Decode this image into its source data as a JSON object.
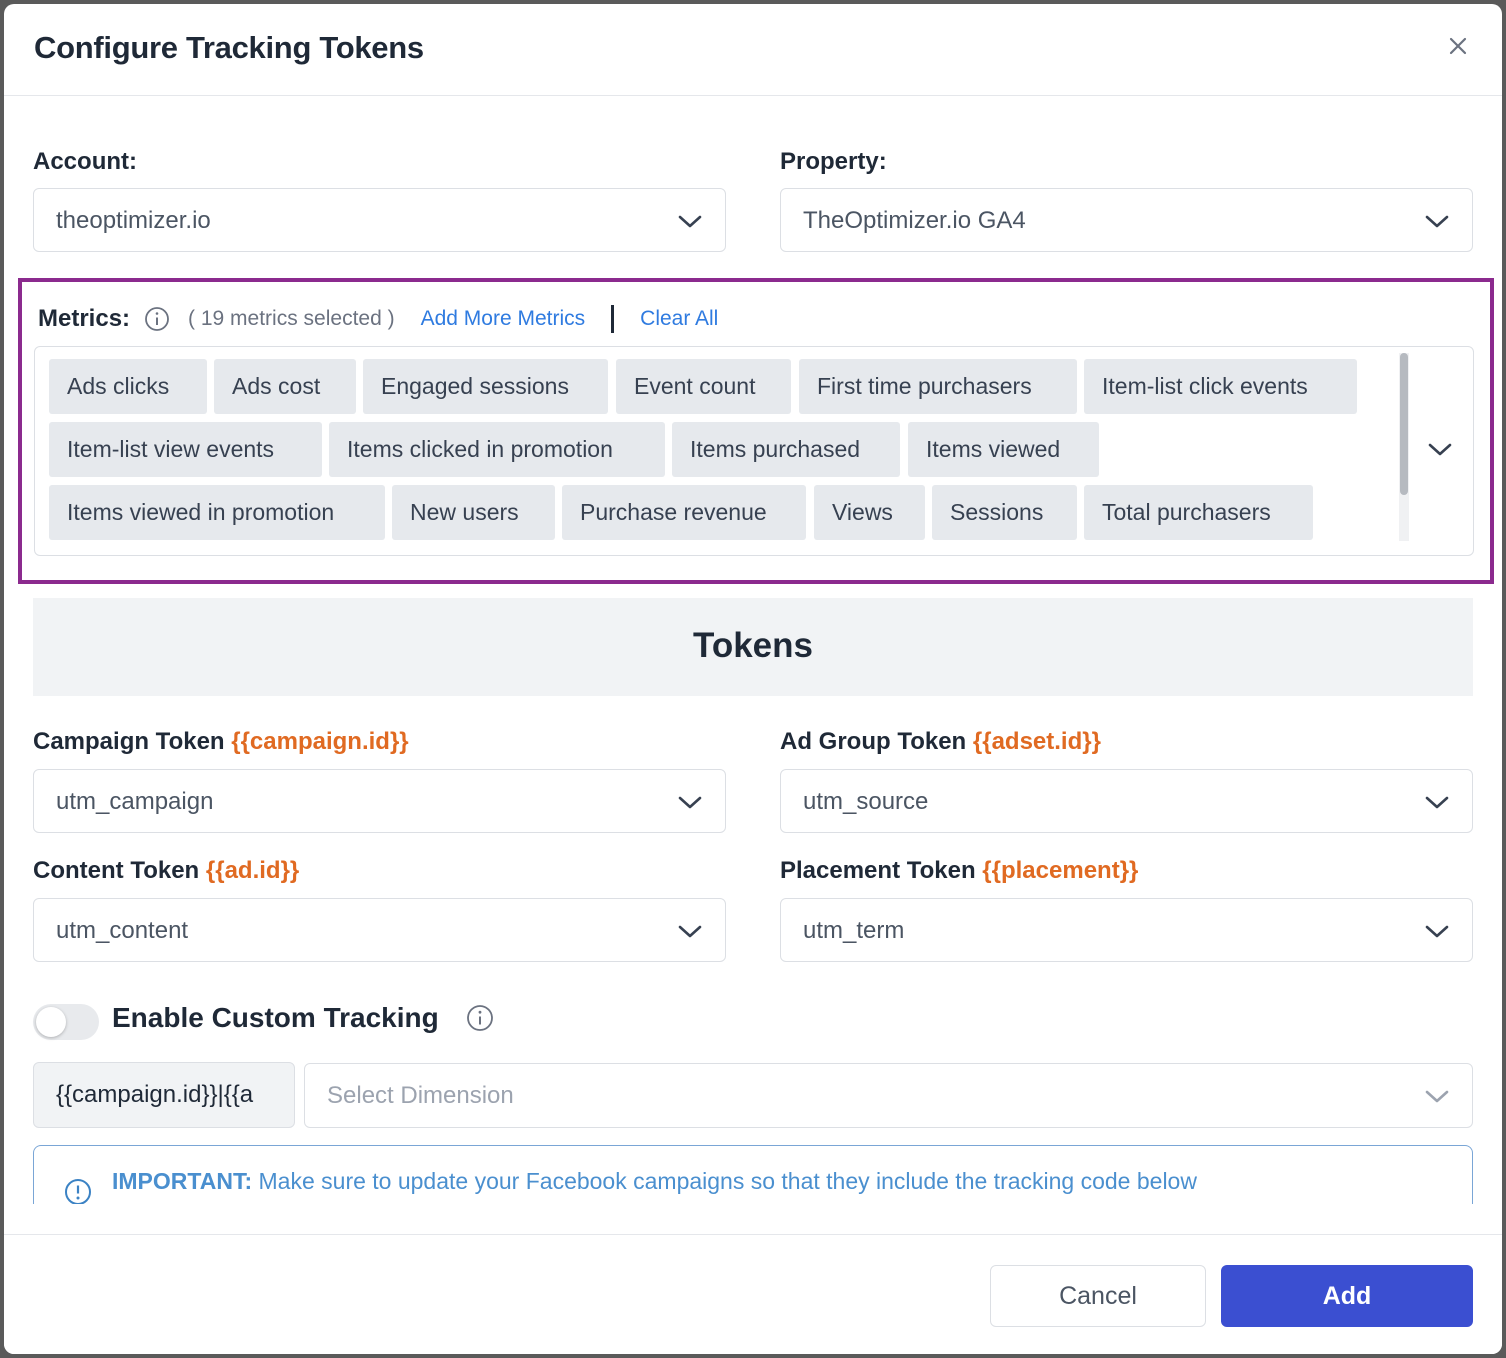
{
  "modal": {
    "title": "Configure Tracking Tokens"
  },
  "account": {
    "label": "Account:",
    "value": "theoptimizer.io"
  },
  "property": {
    "label": "Property:",
    "value": "TheOptimizer.io GA4"
  },
  "metrics": {
    "label": "Metrics:",
    "count_text": "( 19 metrics selected )",
    "add_more": "Add More Metrics",
    "clear_all": "Clear All",
    "chips": [
      "Ads clicks",
      "Ads cost",
      "Engaged sessions",
      "Event count",
      "First time purchasers",
      "Item-list click events",
      "Item-list view events",
      "Items clicked in promotion",
      "Items purchased",
      "Items viewed",
      "Items viewed in promotion",
      "New users",
      "Purchase revenue",
      "Views",
      "Sessions",
      "Total purchasers"
    ]
  },
  "tokens": {
    "heading": "Tokens",
    "campaign": {
      "label": "Campaign Token",
      "token": "{{campaign.id}}",
      "value": "utm_campaign"
    },
    "ad_group": {
      "label": "Ad Group Token",
      "token": "{{adset.id}}",
      "value": "utm_source"
    },
    "content": {
      "label": "Content Token",
      "token": "{{ad.id}}",
      "value": "utm_content"
    },
    "placement": {
      "label": "Placement Token",
      "token": "{{placement}}",
      "value": "utm_term"
    }
  },
  "custom_tracking": {
    "label": "Enable Custom Tracking",
    "enabled": false,
    "token_value": "{{campaign.id}}|{{a",
    "dimension_placeholder": "Select Dimension"
  },
  "notice": {
    "strong": "IMPORTANT:",
    "text": " Make sure to update your Facebook campaigns so that they include the tracking code below"
  },
  "footer": {
    "cancel": "Cancel",
    "add": "Add"
  },
  "colors": {
    "primary": "#3b4fd1",
    "highlight_border": "#8b2a8e",
    "token_orange": "#e06a22",
    "link_blue": "#2f7be0"
  }
}
